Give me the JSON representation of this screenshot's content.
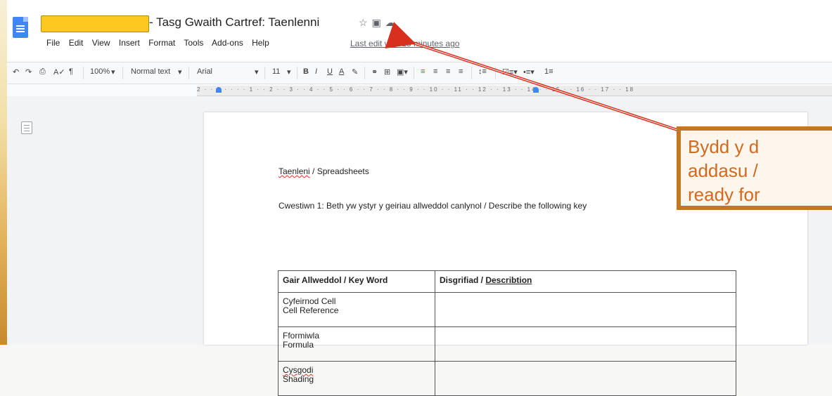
{
  "document": {
    "title": "- Tasg Gwaith Cartref: Taenlenni",
    "title_icons": [
      "star-icon",
      "folder-icon",
      "cloud-icon"
    ]
  },
  "menu": {
    "items": [
      "File",
      "Edit",
      "View",
      "Insert",
      "Format",
      "Tools",
      "Add-ons",
      "Help"
    ],
    "last_edit": "Last edit was 15 minutes ago"
  },
  "toolbar": {
    "zoom": "100%",
    "style": "Normal text",
    "font": "Arial",
    "size": "11",
    "bold": "B",
    "italic": "I",
    "underline": "U",
    "color": "A"
  },
  "ruler": {
    "ticks": "2 · · 1 · · · · 1 · · 2 · · 3 · · 4 · · 5 · · 6 · · 7 · · 8 · · 9 · · 10 · · 11 · · 12 · · 13 · · 14 · · 15 · · 16 · · 17 · · 18"
  },
  "page": {
    "heading_a": "Taenleni",
    "heading_b": " / Spreadsheets",
    "question": "Cwestiwn 1: Beth yw ystyr y geiriau allweddol canlynol / Describe the following key",
    "table": {
      "headers": [
        "Gair Allweddol / Key Word",
        "Disgrifiad / ",
        "Describtion"
      ],
      "rows": [
        {
          "cy": "Cyfeirnod Cell",
          "en": "Cell Reference"
        },
        {
          "cy": "Fformiwla",
          "en": "Formula"
        },
        {
          "cy": "Cysgodi",
          "en": "Shading"
        }
      ]
    }
  },
  "overlay": {
    "line1": "Bydd y d",
    "line2": "addasu /",
    "line3": "ready for",
    "border_color": "#c27722",
    "text_color": "#d2691e"
  },
  "colors": {
    "highlight": "#ffc820",
    "docs_blue": "#4285f4",
    "arrow": "#d7301f"
  }
}
